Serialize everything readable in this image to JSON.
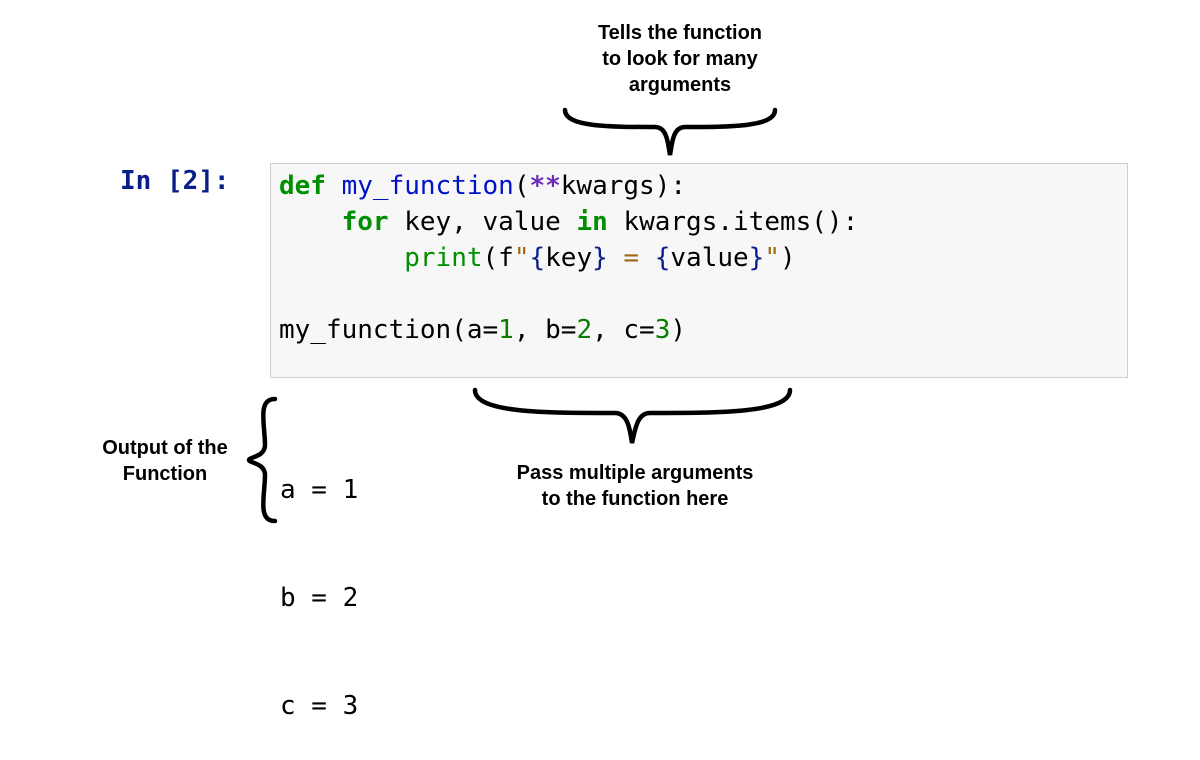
{
  "prompt": "In [2]:",
  "code": {
    "line1": {
      "def": "def",
      "sp1": " ",
      "fn_name": "my_function",
      "open": "(",
      "stars": "**",
      "arg": "kwargs",
      "close": "):"
    },
    "line2": {
      "indent": "    ",
      "for_kw": "for",
      "sp1": " ",
      "key": "key",
      "sp2": ", ",
      "value": "value",
      "sp3": " ",
      "in_kw": "in",
      "sp4": " ",
      "expr": "kwargs.items():"
    },
    "line3": {
      "indent": "        ",
      "print_fn": "print",
      "open": "(f",
      "q1": "\"",
      "brace1": "{",
      "k": "key",
      "brace1c": "}",
      "mid": " = ",
      "brace2": "{",
      "v": "value",
      "brace2c": "}",
      "q2": "\"",
      "close": ")"
    },
    "line5": {
      "fn_name": "my_function",
      "open": "(",
      "a1": "a=",
      "v1": "1",
      "c1": ", ",
      "a2": "b=",
      "v2": "2",
      "c2": ", ",
      "a3": "c=",
      "v3": "3",
      "close": ")"
    }
  },
  "output_lines": {
    "l1": "a = 1",
    "l2": "b = 2",
    "l3": "c = 3"
  },
  "annotations": {
    "top": {
      "l1": "Tells the function",
      "l2": "to look for many",
      "l3": "arguments"
    },
    "left": {
      "l1": "Output of the",
      "l2": "Function"
    },
    "bottom": {
      "l1": "Pass multiple arguments",
      "l2": "to the function here"
    }
  }
}
